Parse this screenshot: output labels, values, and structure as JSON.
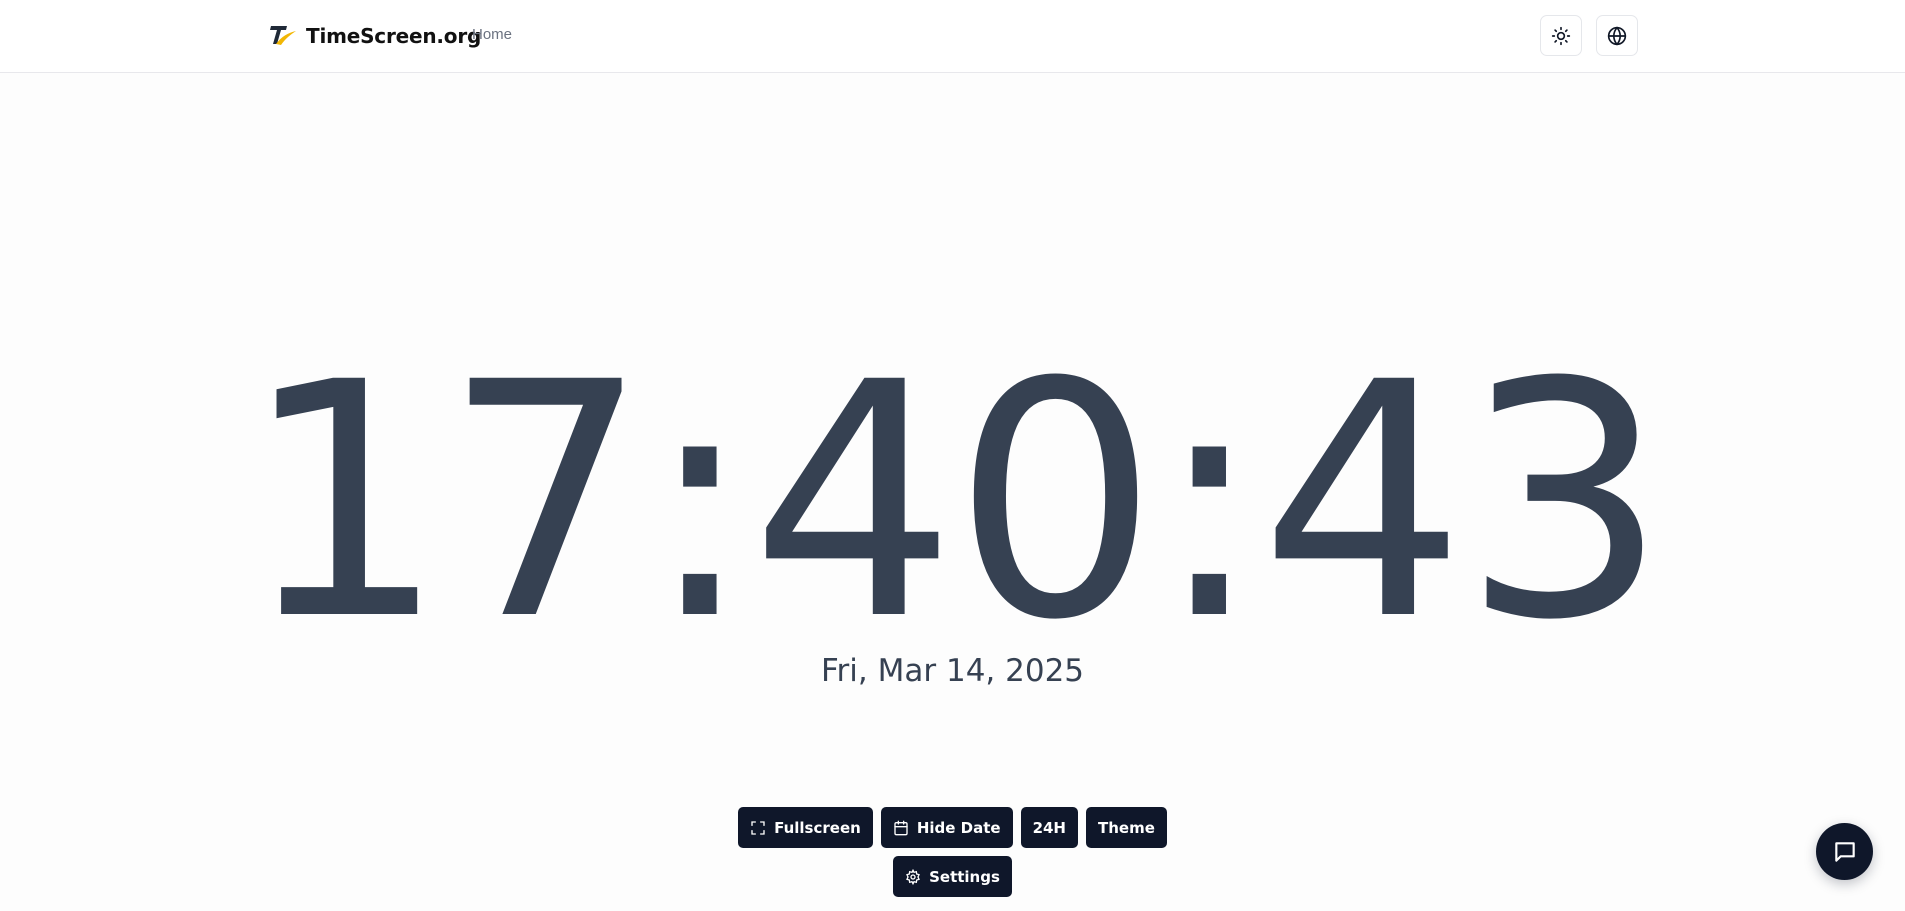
{
  "header": {
    "brand_name": "TimeScreen.org",
    "nav": {
      "home_label": "Home"
    },
    "icons": {
      "theme_toggle": "sun-icon",
      "language": "globe-icon",
      "logo": "timescreen-logo"
    }
  },
  "clock": {
    "time": "17:40:43",
    "date": "Fri, Mar 14, 2025"
  },
  "controls": {
    "fullscreen_label": "Fullscreen",
    "hide_date_label": "Hide Date",
    "format_label": "24H",
    "theme_label": "Theme",
    "settings_label": "Settings"
  },
  "chat": {
    "icon": "chat-bubble-icon"
  },
  "colors": {
    "clock_text": "#364152",
    "button_bg": "#0f172a",
    "button_text": "#ffffff",
    "logo_accent": "#f2b705"
  }
}
